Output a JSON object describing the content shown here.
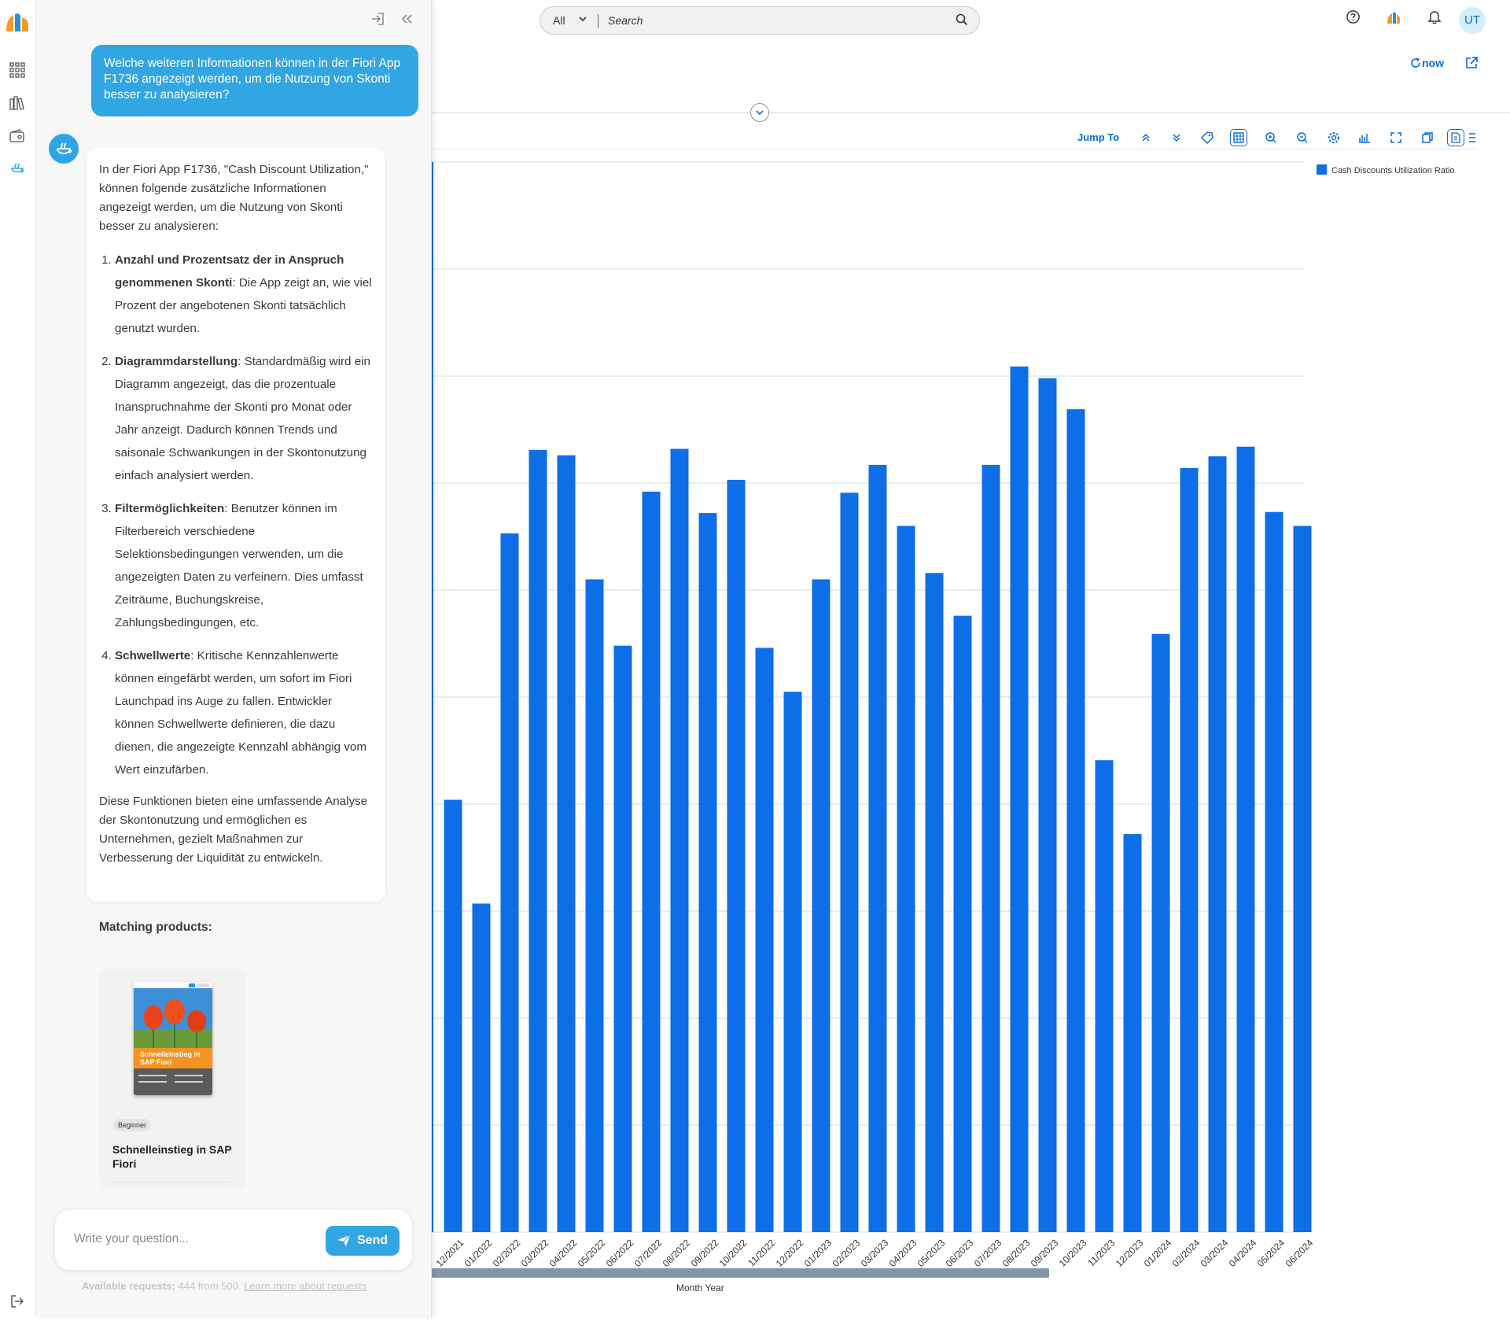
{
  "shell": {
    "search_scope": "All",
    "search_placeholder": "Search",
    "avatar_initials": "UT",
    "refresh_label": "now"
  },
  "toolbar": {
    "jump_to": "Jump To"
  },
  "chat": {
    "question": "Welche weiteren Informationen können in der Fiori App F1736 angezeigt werden, um die Nutzung von Skonti besser zu analysieren?",
    "answer_intro": "In der Fiori App F1736, \"Cash Discount Utilization,\" können folgende zusätzliche Informationen angezeigt werden, um die Nutzung von Skonti besser zu analysieren:",
    "points": [
      {
        "title": "Anzahl und Prozentsatz der in Anspruch genommenen Skonti",
        "text": ": Die App zeigt an, wie viel Prozent der angebotenen Skonti tatsächlich genutzt wurden."
      },
      {
        "title": "Diagrammdarstellung",
        "text": ": Standardmäßig wird ein Diagramm angezeigt, das die prozentuale Inanspruchnahme der Skonti pro Monat oder Jahr anzeigt. Dadurch können Trends und saisonale Schwankungen in der Skontonutzung einfach analysiert werden."
      },
      {
        "title": "Filtermöglichkeiten",
        "text": ": Benutzer können im Filterbereich verschiedene Selektionsbedingungen verwenden, um die angezeigten Daten zu verfeinern. Dies umfasst Zeiträume, Buchungskreise, Zahlungsbedingungen, etc."
      },
      {
        "title": "Schwellwerte",
        "text": ": Kritische Kennzahlenwerte können eingefärbt werden, um sofort im Fiori Launchpad ins Auge zu fallen. Entwickler können Schwellwerte definieren, die dazu dienen, die angezeigte Kennzahl abhängig vom Wert einzufärben."
      }
    ],
    "answer_outro": "Diese Funktionen bieten eine umfassende Analyse der Skontonutzung und ermöglichen es Unternehmen, gezielt Maßnahmen zur Verbesserung der Liquidität zu entwickeln.",
    "matching_label": "Matching products:",
    "product": {
      "badge": "Beginner",
      "title": "Schnelleinstieg in SAP Fiori",
      "cover_title": "Schnelleinstieg in SAP Fiori"
    },
    "input_placeholder": "Write your question...",
    "send_label": "Send",
    "avail_label": "Available requests:",
    "avail_value": "444 from 500.",
    "avail_link": "Learn more about requests"
  },
  "chart_data": {
    "type": "bar",
    "legend": "Cash Discounts Utilization Ratio",
    "legend_position": "top-right",
    "xlabel": "Month Year",
    "grid": true,
    "categories": [
      "12/2021",
      "01/2022",
      "02/2022",
      "03/2022",
      "04/2022",
      "05/2022",
      "06/2022",
      "07/2022",
      "08/2022",
      "09/2022",
      "10/2022",
      "11/2022",
      "12/2022",
      "01/2023",
      "02/2023",
      "03/2023",
      "04/2023",
      "05/2023",
      "06/2023",
      "07/2023",
      "08/2023",
      "09/2023",
      "10/2023",
      "11/2023",
      "12/2023",
      "01/2024",
      "02/2024",
      "03/2024",
      "04/2024",
      "05/2024",
      "06/2024"
    ],
    "values": [
      4.04,
      3.07,
      6.53,
      7.31,
      7.26,
      6.1,
      5.48,
      6.92,
      7.32,
      6.72,
      7.03,
      5.46,
      5.05,
      6.1,
      6.91,
      7.17,
      6.6,
      6.16,
      5.76,
      7.17,
      8.09,
      7.98,
      7.69,
      4.41,
      3.72,
      5.59,
      7.14,
      7.25,
      7.34,
      6.73,
      6.6
    ],
    "ylim": [
      0,
      10
    ]
  },
  "colors": {
    "accent": "#0a6ed1",
    "bar": "#0d6ee8",
    "chat_blue": "#32a6e2"
  }
}
